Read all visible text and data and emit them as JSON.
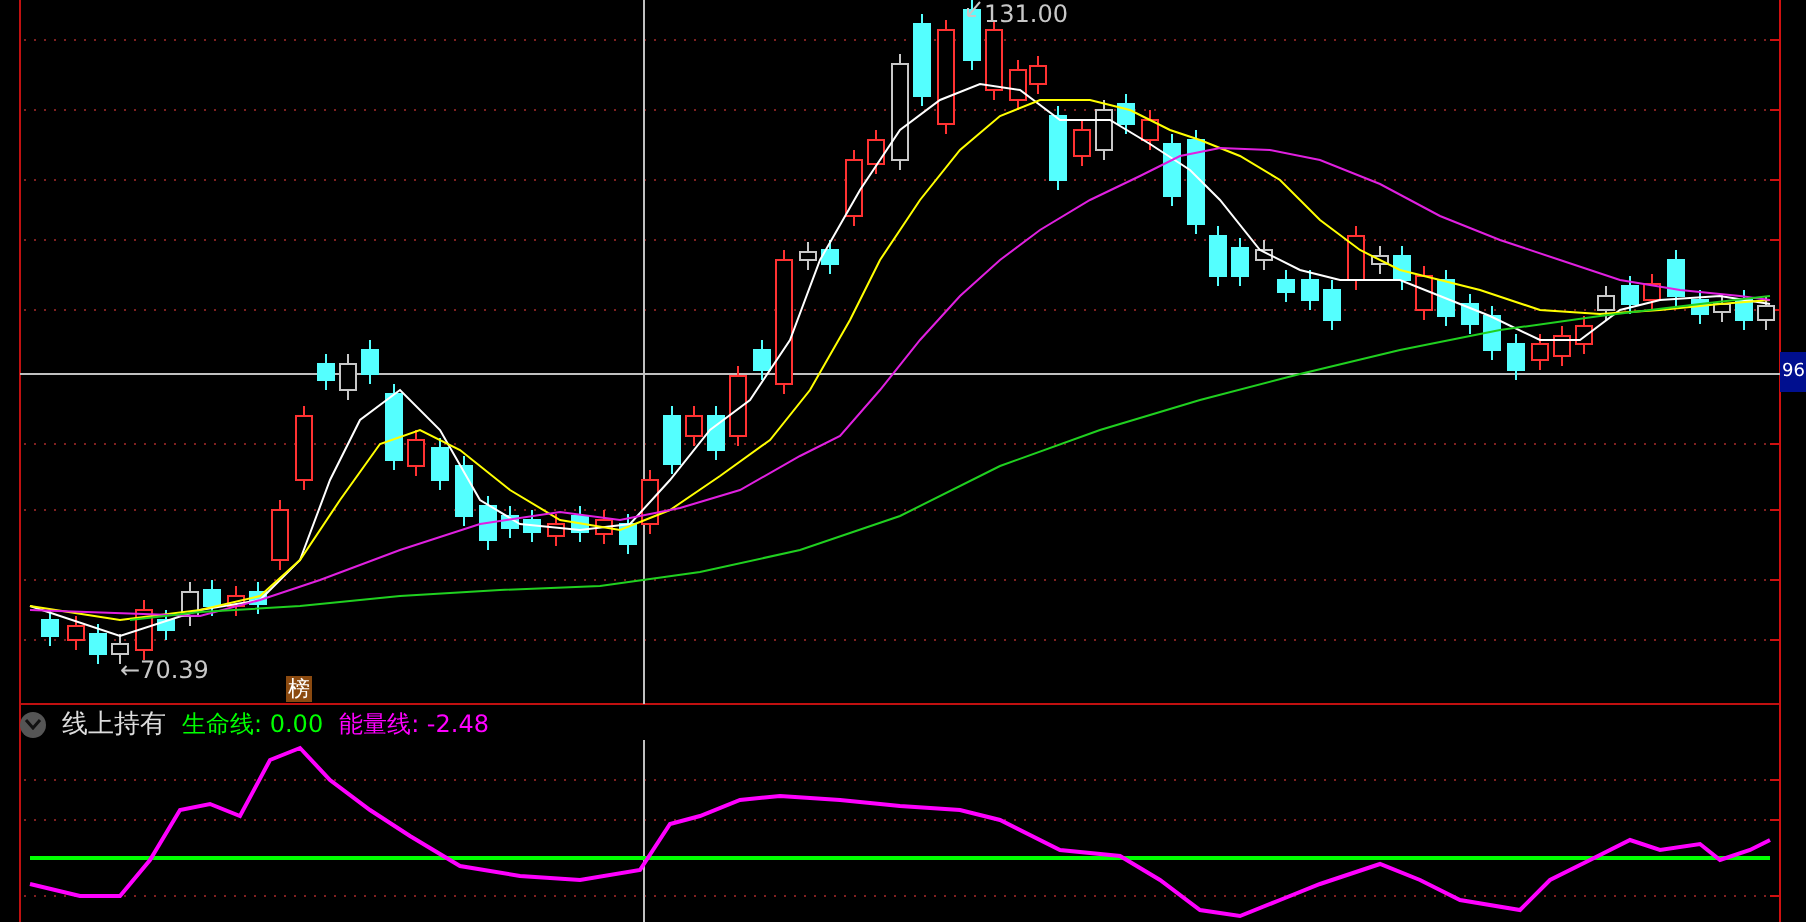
{
  "price_chart": {
    "high_label": "131.00",
    "low_label": "←70.39",
    "price_tag": "96",
    "badge": "榜"
  },
  "indicator": {
    "name": "线上持有",
    "lines": [
      {
        "text": "生命线: 0.00",
        "color": "#00ff00"
      },
      {
        "text": "能量线: -2.48",
        "color": "#ff00ff"
      }
    ]
  }
}
